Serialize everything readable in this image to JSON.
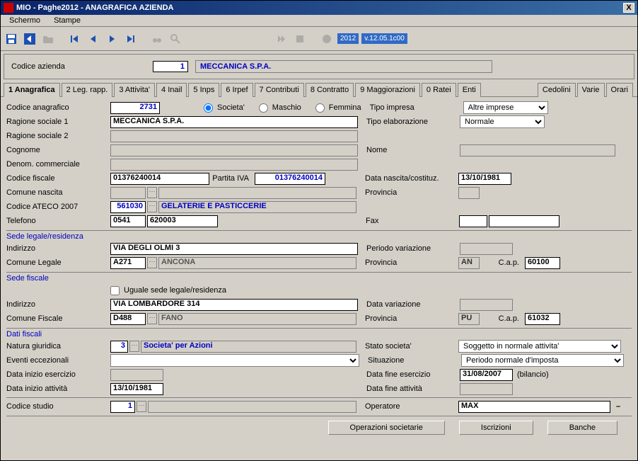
{
  "window": {
    "title": "MIO - Paghe2012 - ANAGRAFICA AZIENDA"
  },
  "menu": {
    "schermo": "Schermo",
    "stampe": "Stampe"
  },
  "toolbar": {
    "year": "2012",
    "version": "v.12.05.1c00"
  },
  "header": {
    "label": "Codice azienda",
    "code": "1",
    "name": "MECCANICA S.P.A."
  },
  "tabs": {
    "t1": "1 Anagrafica",
    "t2": "2 Leg. rapp.",
    "t3": "3 Attivita'",
    "t4": "4 Inail",
    "t5": "5 Inps",
    "t6": "6 Irpef",
    "t7": "7 Contributi",
    "t8": "8 Contratto",
    "t9": "9 Maggiorazioni",
    "t0": "0 Ratei",
    "tEnti": "Enti",
    "tCed": "Cedolini",
    "tVar": "Varie",
    "tOra": "Orari"
  },
  "anag": {
    "codice_label": "Codice anagrafico",
    "codice": "2731",
    "societa": "Societa'",
    "maschio": "Maschio",
    "femmina": "Femmina",
    "tipo_impresa_lbl": "Tipo impresa",
    "tipo_impresa": "Altre imprese",
    "rag1_lbl": "Ragione sociale 1",
    "rag1": "MECCANICA S.P.A.",
    "tipo_elab_lbl": "Tipo elaborazione",
    "tipo_elab": "Normale",
    "rag2_lbl": "Ragione sociale 2",
    "rag2": "",
    "cognome_lbl": "Cognome",
    "cognome": "",
    "nome_lbl": "Nome",
    "nome": "",
    "denom_lbl": "Denom. commerciale",
    "denom": "",
    "cf_lbl": "Codice fiscale",
    "cf": "01376240014",
    "piva_lbl": "Partita IVA",
    "piva": "01376240014",
    "data_nasc_lbl": "Data nascita/costituz.",
    "data_nasc": "13/10/1981",
    "com_nasc_lbl": "Comune nascita",
    "com_nasc": "",
    "prov_lbl": "Provincia",
    "prov": "",
    "ateco_lbl": "Codice ATECO 2007",
    "ateco": "561030",
    "ateco_desc": "GELATERIE E PASTICCERIE",
    "tel_lbl": "Telefono",
    "tel_pre": "0541",
    "tel_num": "620003",
    "fax_lbl": "Fax",
    "fax_pre": "",
    "fax_num": ""
  },
  "sede_legale": {
    "hdr": "Sede legale/residenza",
    "ind_lbl": "Indirizzo",
    "ind": "VIA DEGLI OLMI 3",
    "periodo_lbl": "Periodo variazione",
    "periodo": "",
    "com_lbl": "Comune Legale",
    "com_code": "A271",
    "com_name": "ANCONA",
    "prov_lbl": "Provincia",
    "prov": "AN",
    "cap_lbl": "C.a.p.",
    "cap": "60100"
  },
  "sede_fiscale": {
    "hdr": "Sede fiscale",
    "uguale": "Uguale sede legale/residenza",
    "ind_lbl": "Indirizzo",
    "ind": "VIA LOMBARDORE 314",
    "datavar_lbl": "Data variazione",
    "datavar": "",
    "com_lbl": "Comune Fiscale",
    "com_code": "D488",
    "com_name": "FANO",
    "prov_lbl": "Provincia",
    "prov": "PU",
    "cap_lbl": "C.a.p.",
    "cap": "61032"
  },
  "dati_fiscali": {
    "hdr": "Dati fiscali",
    "natura_lbl": "Natura giuridica",
    "natura_code": "3",
    "natura_desc": "Societa' per Azioni",
    "stato_lbl": "Stato societa'",
    "stato": "Soggetto in normale attivita'",
    "eventi_lbl": "Eventi eccezionali",
    "eventi": "",
    "situazione_lbl": "Situazione",
    "situazione": "Periodo normale d'imposta",
    "inizio_es_lbl": "Data inizio esercizio",
    "inizio_es": "",
    "fine_es_lbl": "Data fine esercizio",
    "fine_es": "31/08/2007",
    "bilancio": "(bilancio)",
    "inizio_att_lbl": "Data inizio attività",
    "inizio_att": "13/10/1981",
    "fine_att_lbl": "Data fine attività",
    "fine_att": ""
  },
  "studio": {
    "code_lbl": "Codice studio",
    "code": "1",
    "desc": "",
    "op_lbl": "Operatore",
    "op": "MAX"
  },
  "buttons": {
    "op_soc": "Operazioni societarie",
    "iscr": "Iscrizioni",
    "banche": "Banche"
  }
}
